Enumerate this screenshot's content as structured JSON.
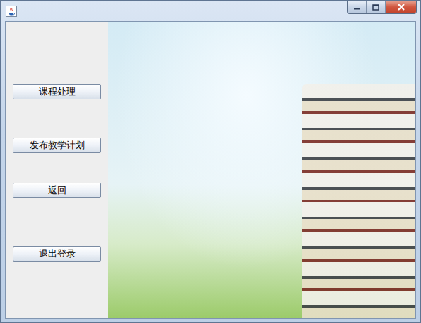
{
  "sidebar": {
    "buttons": [
      {
        "label": "课程处理"
      },
      {
        "label": "发布教学计划"
      },
      {
        "label": "返回"
      },
      {
        "label": "退出登录"
      }
    ]
  }
}
